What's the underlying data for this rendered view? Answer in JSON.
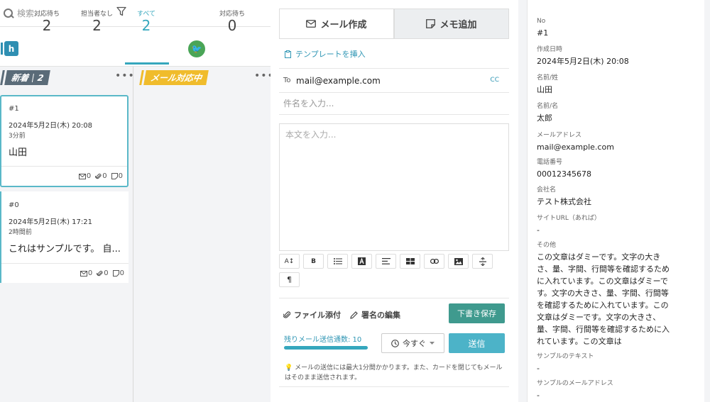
{
  "search": {
    "placeholder": "検索..."
  },
  "stats": [
    {
      "label": "対応待ち",
      "value": "2"
    },
    {
      "label": "担当者なし",
      "value": "2"
    },
    {
      "label": "すべて",
      "value": "2"
    },
    {
      "label": "対応待ち",
      "value": "0"
    }
  ],
  "badge": {
    "letter": "h"
  },
  "columns": {
    "new": {
      "label": "新着",
      "count": "2"
    },
    "mail": {
      "label": "メール対応中"
    },
    "more": "•••"
  },
  "cards": [
    {
      "id": "#1",
      "date": "2024年5月2日(木) 20:08",
      "ago": "3分前",
      "name": "山田",
      "mail": "0",
      "attach": "0",
      "memo": "0"
    },
    {
      "id": "#0",
      "date": "2024年5月2日(木) 17:21",
      "ago": "2時間前",
      "name": "これはサンプルです。 自...",
      "mail": "0",
      "attach": "0",
      "memo": "0"
    }
  ],
  "composer": {
    "tab_mail": "メール作成",
    "tab_memo": "メモ追加",
    "template": "テンプレートを挿入",
    "to_label": "To",
    "to_address": "mail@example.com",
    "cc": "CC",
    "subject_placeholder": "件名を入力...",
    "body_placeholder": "本文を入力...",
    "attach": "ファイル添付",
    "signature": "署名の編集",
    "draft": "下書き保存",
    "remaining": "残りメール送信通数: 10",
    "remaining_fraction": 1.0,
    "schedule": "今すぐ",
    "send": "送信",
    "note": "メールの送信には最大1分間かかります。また、カードを閉じてもメールはそのまま送信されます。"
  },
  "details": [
    {
      "key": "No",
      "value": "#1"
    },
    {
      "key": "作成日時",
      "value": "2024年5月2日(木) 20:08"
    },
    {
      "key": "名前/姓",
      "value": "山田"
    },
    {
      "key": "名前/名",
      "value": "太郎"
    },
    {
      "key": "メールアドレス",
      "value": "mail@example.com"
    },
    {
      "key": "電話番号",
      "value": "00012345678"
    },
    {
      "key": "会社名",
      "value": "テスト株式会社"
    },
    {
      "key": "サイトURL（あれば）",
      "value": "-"
    },
    {
      "key": "その他",
      "value": "この文章はダミーです。文字の大きさ、量、字間、行間等を確認するために入れています。この文章はダミーです。文字の大きさ、量、字間、行間等を確認するために入れています。この文章はダミーです。文字の大きさ、量、字間、行間等を確認するために入れています。この文章は"
    },
    {
      "key": "サンプルのテキスト",
      "value": "-"
    },
    {
      "key": "サンプルのメールアドレス",
      "value": "-"
    }
  ],
  "colors": {
    "accent": "#35a7bd",
    "draft_button": "#3f9a8e",
    "send_button": "#4cb3c8",
    "new_column": "#5a6b78",
    "mail_column": "#f0bc2c"
  }
}
